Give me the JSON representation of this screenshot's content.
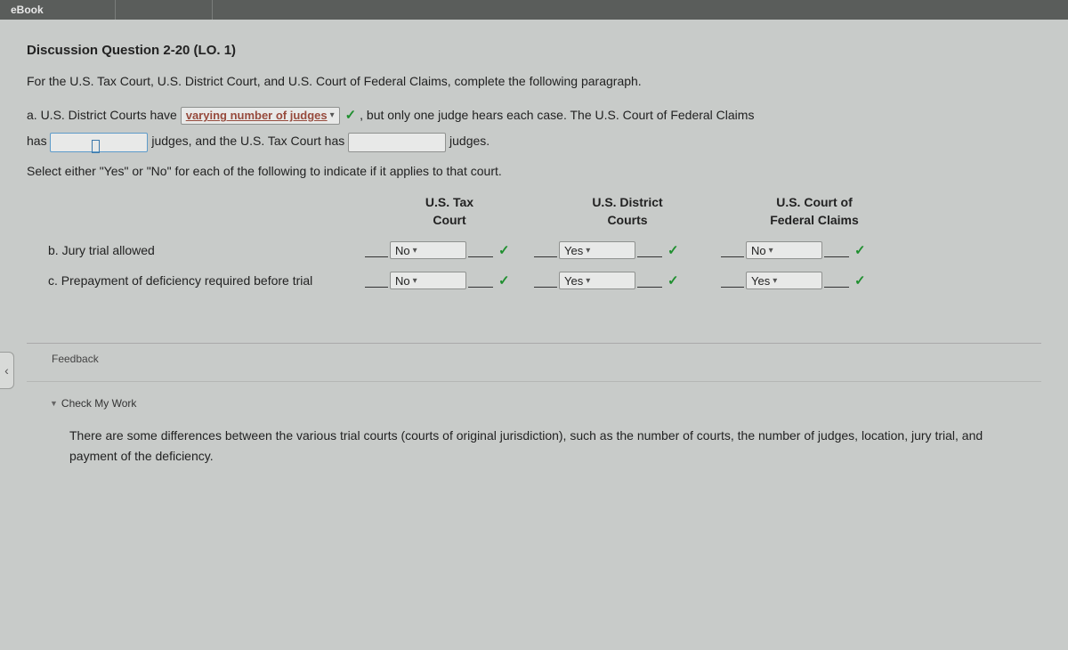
{
  "topbar": {
    "ebook": "eBook"
  },
  "title": "Discussion Question 2-20 (LO. 1)",
  "intro": "For the U.S. Tax Court, U.S. District Court, and U.S. Court of Federal Claims, complete the following paragraph.",
  "partA": {
    "prefix": "a.  U.S. District Courts have",
    "dropdown_value": "varying number of judges",
    "after_dd": ", but only one judge hears each case. The U.S. Court of Federal Claims",
    "has": "has",
    "mid": "judges, and the U.S. Tax Court has",
    "end": "judges."
  },
  "sub_instruction": "Select either \"Yes\" or \"No\" for each of the following to indicate if it applies to that court.",
  "table": {
    "headers": {
      "col1": "U.S. Tax\nCourt",
      "col2": "U.S. District\nCourts",
      "col3": "U.S. Court of\nFederal Claims"
    },
    "rows": [
      {
        "label": "b.  Jury trial allowed",
        "c1": "No",
        "c2": "Yes",
        "c3": "No"
      },
      {
        "label": "c.  Prepayment of deficiency required before trial",
        "c1": "No",
        "c2": "Yes",
        "c3": "Yes"
      }
    ]
  },
  "feedback": {
    "heading": "Feedback",
    "check_label": "Check My Work",
    "body": "There are some differences between the various trial courts (courts of original jurisdiction), such as the number of courts, the number of judges, location, jury trial, and payment of the deficiency."
  },
  "icons": {
    "check": "✓",
    "caret": "▾",
    "tri_down": "▼",
    "chevron_left": "‹"
  }
}
